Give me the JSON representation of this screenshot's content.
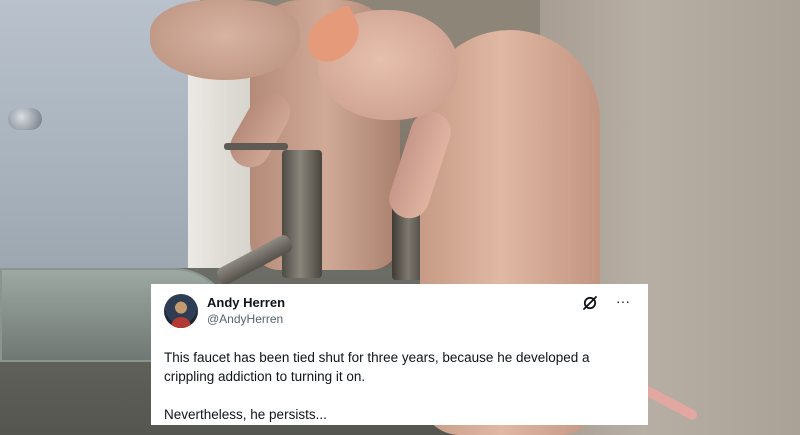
{
  "tweet": {
    "author_name": "Andy Herren",
    "author_handle": "@AndyHerren",
    "text_line_1": "This faucet has been tied shut for three years, because he developed a",
    "text_line_2": "crippling addiction to turning it on.",
    "text_line_3": "Nevertheless, he persists...",
    "more_label": "···",
    "icons": [
      "avatar",
      "grok-icon",
      "more-icon"
    ]
  },
  "colors": {
    "card_background": "#ffffff",
    "name_text": "#0f1419",
    "handle_text": "#536471"
  }
}
